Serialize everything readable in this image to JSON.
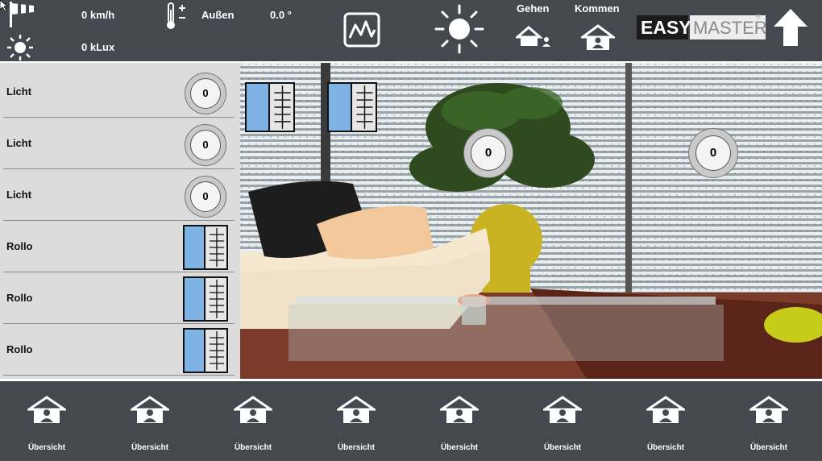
{
  "weather": {
    "wind_speed": "0 km/h",
    "brightness": "0 kLux",
    "temp_label": "Außen",
    "temp_value": "0.0 °"
  },
  "presence": {
    "away_label": "Gehen",
    "home_label": "Kommen"
  },
  "logo": {
    "part1": "EASY",
    "part2": "MASTER",
    "registered": "®"
  },
  "sidebar": {
    "items": [
      {
        "label": "Licht",
        "type": "dimmer",
        "value": "0"
      },
      {
        "label": "Licht",
        "type": "dimmer",
        "value": "0"
      },
      {
        "label": "Licht",
        "type": "dimmer",
        "value": "0"
      },
      {
        "label": "Rollo",
        "type": "blind"
      },
      {
        "label": "Rollo",
        "type": "blind"
      },
      {
        "label": "Rollo",
        "type": "blind"
      }
    ]
  },
  "room_controls": {
    "dimmer_1_value": "0",
    "dimmer_2_value": "0"
  },
  "bottom_nav": {
    "items": [
      {
        "label": "Übersicht",
        "icon": "house-person-icon"
      },
      {
        "label": "Übersicht",
        "icon": "house-person-icon"
      },
      {
        "label": "Übersicht",
        "icon": "house-person-icon"
      },
      {
        "label": "Übersicht",
        "icon": "house-person-icon"
      },
      {
        "label": "Übersicht",
        "icon": "house-person-icon"
      },
      {
        "label": "Übersicht",
        "icon": "house-person-icon"
      },
      {
        "label": "Übersicht",
        "icon": "house-person-icon"
      },
      {
        "label": "Übersicht",
        "icon": "house-person-icon"
      }
    ]
  },
  "colors": {
    "bar_background": "#45494f",
    "sidebar_background": "#dcdcdc",
    "blind_blue": "#7fb3e6"
  }
}
